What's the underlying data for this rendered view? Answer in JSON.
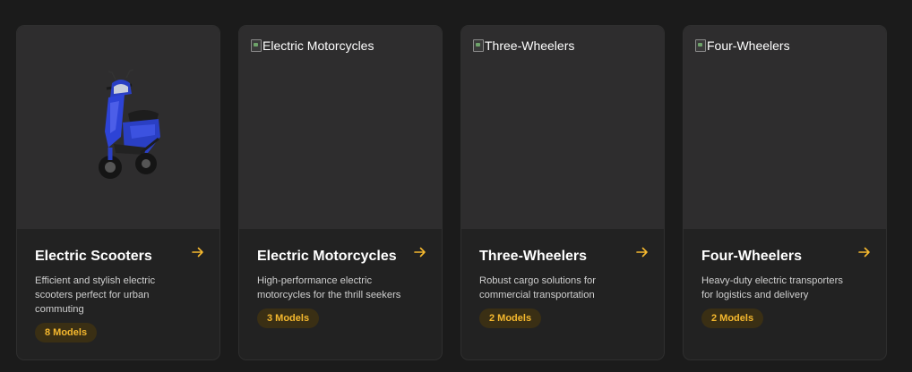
{
  "accent_color": "#f5b82e",
  "cards": [
    {
      "title": "Electric Scooters",
      "description": "Efficient and stylish electric scooters perfect for urban commuting",
      "badge": "8 Models",
      "image_alt": "",
      "image_icon": "blue-electric-scooter-photo",
      "arrow_icon": "arrow-right-icon"
    },
    {
      "title": "Electric Motorcycles",
      "description": "High-performance electric motorcycles for the thrill seekers",
      "badge": "3 Models",
      "image_alt": "Electric Motorcycles",
      "image_icon": "broken-image-icon",
      "arrow_icon": "arrow-right-icon"
    },
    {
      "title": "Three-Wheelers",
      "description": "Robust cargo solutions for commercial transportation",
      "badge": "2 Models",
      "image_alt": "Three-Wheelers",
      "image_icon": "broken-image-icon",
      "arrow_icon": "arrow-right-icon"
    },
    {
      "title": "Four-Wheelers",
      "description": "Heavy-duty electric transporters for logistics and delivery",
      "badge": "2 Models",
      "image_alt": "Four-Wheelers",
      "image_icon": "broken-image-icon",
      "arrow_icon": "arrow-right-icon"
    }
  ]
}
